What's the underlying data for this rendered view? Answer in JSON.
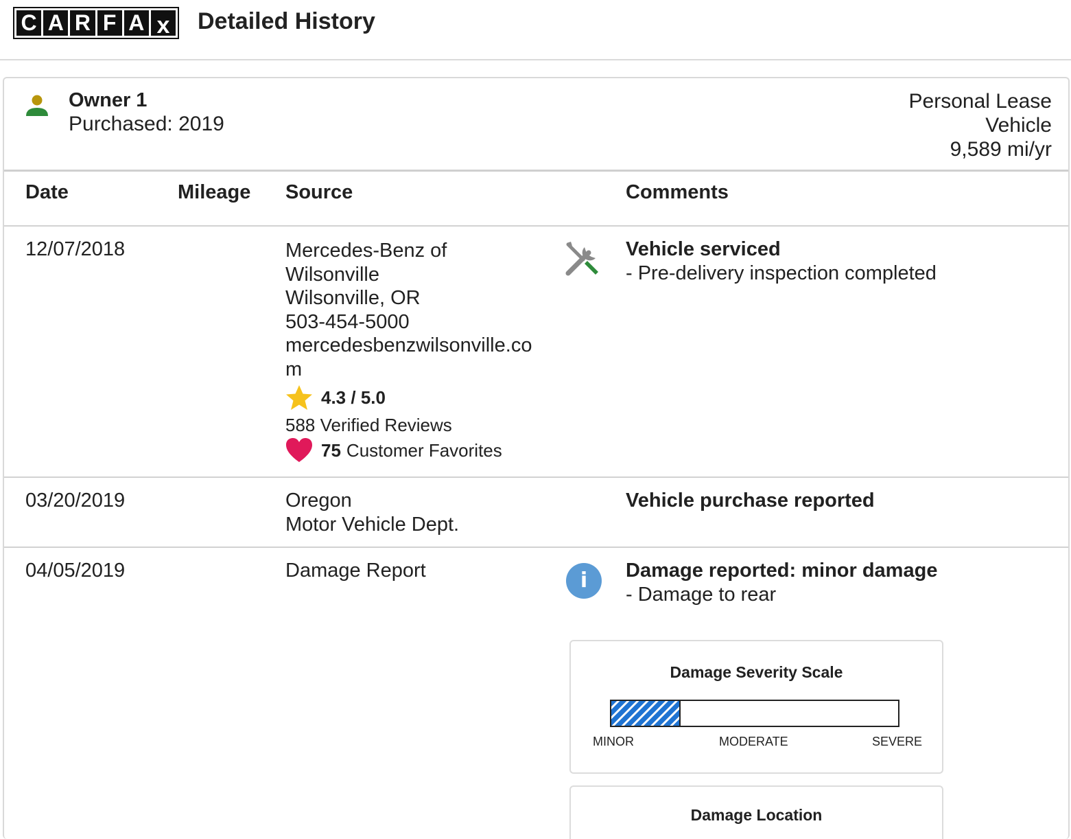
{
  "header": {
    "logo_letters": [
      "C",
      "A",
      "R",
      "F",
      "A",
      "x"
    ],
    "title": "Detailed History"
  },
  "owner": {
    "title": "Owner 1",
    "purchased": "Purchased: 2019",
    "type_line1": "Personal Lease",
    "type_line2": "Vehicle",
    "usage": "9,589 mi/yr",
    "icon": "person-icon",
    "colors": {
      "head": "#b8960c",
      "body": "#2e8b3a"
    }
  },
  "table": {
    "columns": [
      "Date",
      "Mileage",
      "Source",
      "Comments"
    ],
    "rows": [
      {
        "date": "12/07/2018",
        "mileage": "",
        "source_lines": [
          "Mercedes-Benz of",
          "Wilsonville",
          "Wilsonville, OR",
          "503-454-5000",
          "mercedesbenzwilsonville.co",
          "m"
        ],
        "rating": "4.3 / 5.0",
        "reviews": "588 Verified Reviews",
        "favorites_count": "75",
        "favorites_label": "Customer Favorites",
        "icon": "wrench-screwdriver-icon",
        "comment_title": "Vehicle serviced",
        "comment_detail": "- Pre-delivery inspection completed"
      },
      {
        "date": "03/20/2019",
        "mileage": "",
        "source_lines": [
          "Oregon",
          "Motor Vehicle Dept."
        ],
        "comment_title": "Vehicle purchase reported"
      },
      {
        "date": "04/05/2019",
        "mileage": "",
        "source_lines": [
          "Damage Report"
        ],
        "icon": "info-icon",
        "comment_title": "Damage reported: minor damage",
        "comment_detail": "- Damage to rear"
      }
    ]
  },
  "damage_severity": {
    "title": "Damage Severity Scale",
    "level_fraction": 0.24,
    "labels": [
      "MINOR",
      "MODERATE",
      "SEVERE"
    ],
    "fill_color": "#1e73d2"
  },
  "damage_location": {
    "title": "Damage Location"
  },
  "colors": {
    "star": "#f6c21c",
    "heart": "#e0195a",
    "info": "#5b9bd5"
  }
}
